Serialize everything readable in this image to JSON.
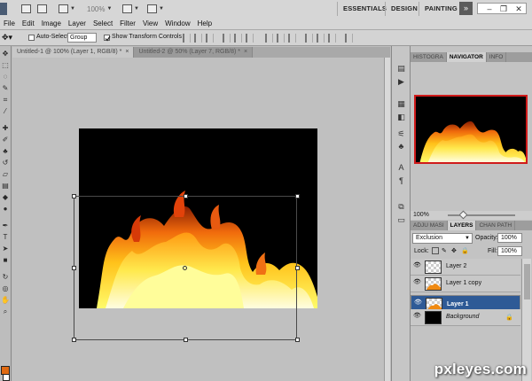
{
  "menubar": {
    "zoom_value": "100%",
    "workspaces": [
      "ESSENTIALS",
      "DESIGN",
      "PAINTING"
    ],
    "more_label": "»",
    "window_controls": {
      "minimize": "–",
      "restore": "❐",
      "close": "✕"
    },
    "menus": [
      "File",
      "Edit",
      "Image",
      "Layer",
      "Select",
      "Filter",
      "View",
      "Window",
      "Help"
    ]
  },
  "options": {
    "auto_select_label": "Auto-Select:",
    "auto_select_checked": false,
    "auto_select_target": "Group",
    "show_transform_label": "Show Transform Controls",
    "show_transform_checked": true
  },
  "document_tabs": [
    {
      "label": "Untitled-1 @ 100% (Layer 1, RGB/8) *",
      "close": "×",
      "active": true
    },
    {
      "label": "Untitled-2 @ 50% (Layer 7, RGB/8) *",
      "close": "×",
      "active": false
    }
  ],
  "panels": {
    "top_tabs": [
      "HISTOGRA",
      "NAVIGATOR",
      "INFO"
    ],
    "active_top_tab": "NAVIGATOR",
    "navigator_zoom": "100%",
    "layer_tabs": [
      "ADJU MASI",
      "LAYERS",
      "CHAN PATH"
    ],
    "active_layer_tab": "LAYERS",
    "blend_mode": "Exclusion",
    "opacity_label": "Opacity:",
    "opacity_value": "100%",
    "lock_label": "Lock:",
    "fill_label": "Fill:",
    "fill_value": "100%"
  },
  "layers": [
    {
      "name": "Layer 2",
      "selected": false,
      "thumb": "transparent"
    },
    {
      "name": "Layer 1 copy",
      "selected": false,
      "thumb": "fire"
    },
    {
      "name": "Layer 1",
      "selected": true,
      "thumb": "fire"
    },
    {
      "name": "Background",
      "selected": false,
      "thumb": "black",
      "locked": true
    }
  ],
  "colors": {
    "foreground": "#e06a12",
    "background": "#ffffff",
    "selection": "#2e5a96",
    "navigator_frame": "#d01b1b"
  },
  "icons": {
    "lock": "padlock-icon",
    "eye": "eye-icon"
  },
  "watermark": "pxleyes.com"
}
